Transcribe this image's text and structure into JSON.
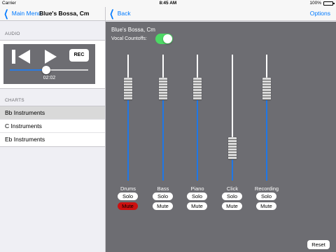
{
  "status_bar": {
    "carrier": "Carrier",
    "time": "8:45 AM",
    "battery": "100%"
  },
  "left_nav": {
    "back_label": "Main Menu",
    "title": "Blue's Bossa, Cm"
  },
  "audio": {
    "section_header": "AUDIO",
    "rec_label": "REC",
    "time": "02:02",
    "progress": 0.46
  },
  "charts": {
    "section_header": "CHARTS",
    "items": [
      {
        "label": "Bb Instruments",
        "selected": true
      },
      {
        "label": "C Instruments",
        "selected": false
      },
      {
        "label": "Eb Instruments",
        "selected": false
      }
    ]
  },
  "right_nav": {
    "back_label": "Back",
    "options_label": "Options"
  },
  "mixer": {
    "song_title": "Blue's Bossa, Cm",
    "vocal_countoffs_label": "Vocal Countoffs:",
    "vocal_countoffs_on": true,
    "solo_label": "Solo",
    "mute_label": "Mute",
    "reset_label": "Reset",
    "mute_active_color": "#cc1010",
    "fader_color": "#1f77e6",
    "channels": [
      {
        "name": "Drums",
        "level": 0.78,
        "muted": true
      },
      {
        "name": "Bass",
        "level": 0.78,
        "muted": false
      },
      {
        "name": "Piano",
        "level": 0.78,
        "muted": false
      },
      {
        "name": "Click",
        "level": 0.2,
        "muted": false
      },
      {
        "name": "Recording",
        "level": 0.78,
        "muted": false
      }
    ]
  }
}
